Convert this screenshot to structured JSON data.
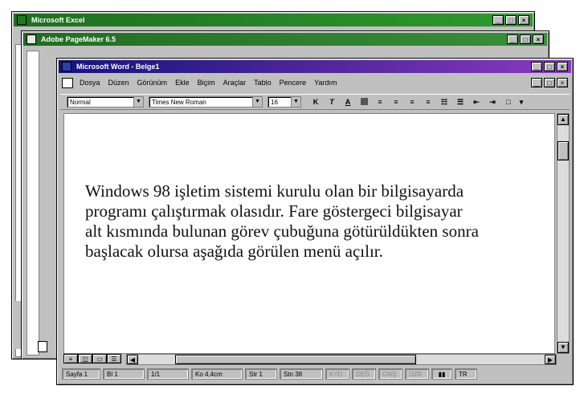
{
  "colors": {
    "excel_title": "#1f7a1f",
    "pagemaker_title": "#2e7d32",
    "word_title_start": "#1a1a8c",
    "word_title_end": "#6b2fb5",
    "face": "#c0c0c0"
  },
  "excel": {
    "title": "Microsoft Excel",
    "controls": [
      "_",
      "□",
      "×"
    ]
  },
  "pagemaker": {
    "title": "Adobe PageMaker 6.5",
    "controls": [
      "_",
      "□",
      "×"
    ]
  },
  "word": {
    "title": "Microsoft Word - Belge1",
    "controls": [
      "_",
      "□",
      "×"
    ],
    "doc_controls": [
      "_",
      "□",
      "×"
    ],
    "menus": [
      "Dosya",
      "Düzen",
      "Görünüm",
      "Ekle",
      "Biçim",
      "Araçlar",
      "Tablo",
      "Pencere",
      "Yardım"
    ],
    "style_value": "Normal",
    "font_value": "Times New Roman",
    "size_value": "16",
    "format_buttons": [
      "K",
      "T",
      "A"
    ],
    "document_lines": [
      "Windows 98 işletim sistemi kurulu olan bir bilgisayarda",
      "programı çalıştırmak olasıdır. Fare göstergeci bilgisayar",
      "alt kısmında bulunan görev çubuğuna götürüldükten sonra",
      "başlacak olursa aşağıda görülen menü açılır."
    ],
    "status": {
      "page": "Sayfa 1",
      "section": "Bl 1",
      "pages": "1/1",
      "position": "Ko 4,4cm",
      "line": "Str 1",
      "column": "Stn 38",
      "flags": [
        "KYD",
        "DEĞ",
        "GNŞ",
        "ÜZR"
      ],
      "lang": "TR"
    }
  }
}
